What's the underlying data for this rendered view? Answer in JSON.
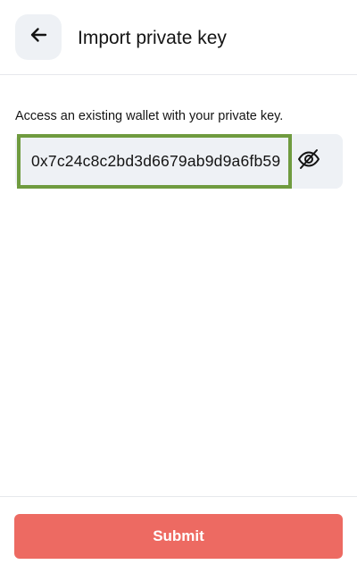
{
  "header": {
    "title": "Import private key",
    "back_icon": "arrow-left-icon"
  },
  "form": {
    "description": "Access an existing wallet with your private key.",
    "private_key_value": "0x7c24c8c2bd3d6679ab9d9a6fb59",
    "visibility_icon": "eye-off-icon",
    "input_focus_color": "#6f9b3f"
  },
  "footer": {
    "submit_label": "Submit",
    "submit_color": "#ed6a62"
  }
}
